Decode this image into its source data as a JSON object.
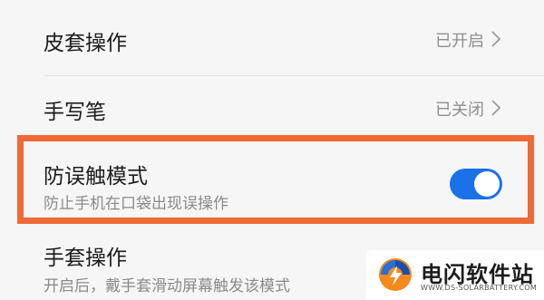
{
  "settings": {
    "items": [
      {
        "title": "皮套操作",
        "value": "已开启",
        "control": "chevron"
      },
      {
        "title": "手写笔",
        "value": "已关闭",
        "control": "chevron"
      },
      {
        "title": "防误触模式",
        "subtitle": "防止手机在口袋出现误操作",
        "control": "toggle",
        "toggle_on": true
      },
      {
        "title": "手套操作",
        "subtitle": "开启后，戴手套滑动屏幕触发该模式",
        "control": "toggle"
      }
    ]
  },
  "colors": {
    "accent": "#1b72e8",
    "highlight": "#ee6a36",
    "title_text": "#1c1c1c",
    "secondary_text": "#8a8a8a"
  },
  "icons": {
    "chevron": "chevron-right-icon",
    "watermark_logo": "lightning-badge-icon"
  },
  "watermark": {
    "name": "电闪软件站",
    "url": "WWW.DS-SOLARBATTERY.COM"
  }
}
